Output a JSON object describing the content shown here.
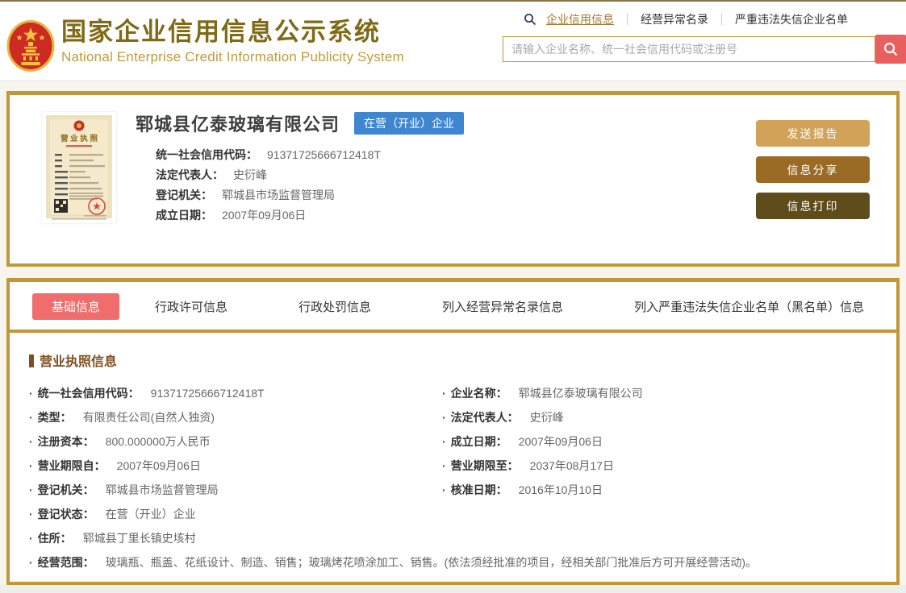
{
  "header": {
    "site_title": "国家企业信用信息公示系统",
    "site_subtitle": "National Enterprise Credit Information Publicity System",
    "nav_links": [
      {
        "label": "企业信用信息",
        "active": true
      },
      {
        "label": "经营异常名录",
        "active": false
      },
      {
        "label": "严重违法失信企业名单",
        "active": false
      }
    ],
    "search_placeholder": "请输入企业名称、统一社会信用代码或注册号"
  },
  "company_card": {
    "license_title": "营 业 执 照",
    "company_name": "郓城县亿泰玻璃有限公司",
    "status_badge": {
      "label": "在营（开业）企业",
      "color": "#3e86d0"
    },
    "fields": [
      {
        "label": "统一社会信用代码：",
        "value": "91371725666712418T"
      },
      {
        "label": "法定代表人：",
        "value": "史衍峰"
      },
      {
        "label": "登记机关：",
        "value": "郓城县市场监督管理局"
      },
      {
        "label": "成立日期：",
        "value": "2007年09月06日"
      }
    ],
    "action_buttons": [
      {
        "name": "send-report-button",
        "label": "发送报告",
        "color": "#d1a257"
      },
      {
        "name": "info-share-button",
        "label": "信息分享",
        "color": "#9a6b25"
      },
      {
        "name": "info-print-button",
        "label": "信息打印",
        "color": "#5e4d1b"
      }
    ]
  },
  "tabs": [
    {
      "label": "基础信息",
      "active": true
    },
    {
      "label": "行政许可信息",
      "active": false
    },
    {
      "label": "行政处罚信息",
      "active": false
    },
    {
      "label": "列入经营异常名录信息",
      "active": false
    },
    {
      "label": "列入严重违法失信企业名单（黑名单）信息",
      "active": false
    }
  ],
  "detail": {
    "section_title": "营业执照信息",
    "rows": [
      {
        "left": {
          "label": "统一社会信用代码：",
          "value": "91371725666712418T"
        },
        "right": {
          "label": "企业名称：",
          "value": "郓城县亿泰玻璃有限公司"
        }
      },
      {
        "left": {
          "label": "类型：",
          "value": "有限责任公司(自然人独资)"
        },
        "right": {
          "label": "法定代表人：",
          "value": "史衍峰"
        }
      },
      {
        "left": {
          "label": "注册资本：",
          "value": "800.000000万人民币"
        },
        "right": {
          "label": "成立日期：",
          "value": "2007年09月06日"
        }
      },
      {
        "left": {
          "label": "营业期限自：",
          "value": "2007年09月06日"
        },
        "right": {
          "label": "营业期限至：",
          "value": "2037年08月17日"
        }
      },
      {
        "left": {
          "label": "登记机关：",
          "value": "郓城县市场监督管理局"
        },
        "right": {
          "label": "核准日期：",
          "value": "2016年10月10日"
        }
      },
      {
        "left": {
          "label": "登记状态：",
          "value": "在营（开业）企业"
        },
        "right": null
      },
      {
        "left": {
          "label": "住所：",
          "value": "郓城县丁里长镇史垓村"
        },
        "right": null
      },
      {
        "full": {
          "label": "经营范围：",
          "value": "玻璃瓶、瓶盖、花纸设计、制造、销售；玻璃烤花喷涂加工、销售。(依法须经批准的项目，经相关部门批准后方可开展经营活动)。"
        }
      }
    ]
  },
  "colors": {
    "gold_border": "#c39738",
    "active_tab_red": "#f06d6d",
    "search_button_red": "#e95f5f",
    "title_gold": "#806a16",
    "subtitle_gold": "#c09a3e"
  }
}
